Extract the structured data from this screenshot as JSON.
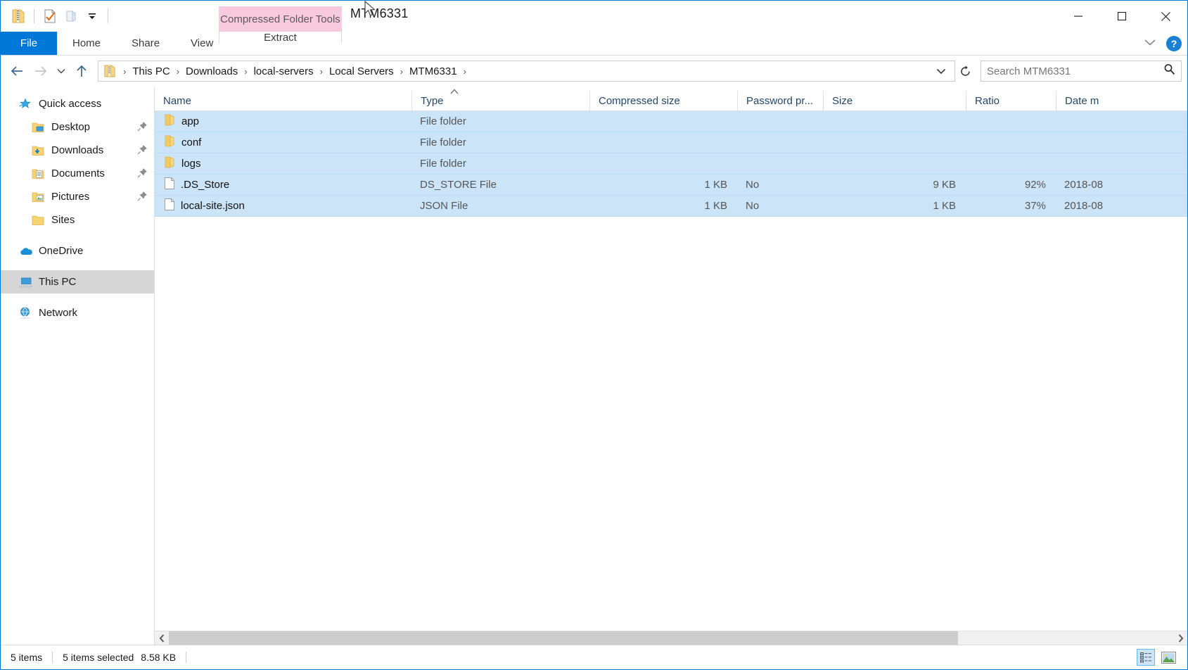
{
  "window": {
    "title": "MTM6331",
    "contextual_tab_group": "Compressed Folder Tools",
    "minimize_label": "Minimize",
    "maximize_label": "Maximize",
    "close_label": "Close",
    "ribbon_collapse_label": "Minimize the Ribbon",
    "help_label": "?"
  },
  "quick_access_toolbar": {
    "items": [
      {
        "name": "zipped-folder-icon",
        "label": "Compressed Folder"
      },
      {
        "name": "properties-icon",
        "label": "Properties"
      },
      {
        "name": "new-folder-icon",
        "label": "New folder"
      },
      {
        "name": "customize-dropdown-icon",
        "label": "Customize Quick Access Toolbar"
      }
    ]
  },
  "ribbon": {
    "tabs": [
      {
        "label": "File",
        "selected": true
      },
      {
        "label": "Home",
        "selected": false
      },
      {
        "label": "Share",
        "selected": false
      },
      {
        "label": "View",
        "selected": false
      }
    ],
    "contextual_tab": {
      "label": "Extract",
      "selected": false
    }
  },
  "address_bar": {
    "back_label": "Back",
    "forward_label": "Forward",
    "recent_label": "Recent locations",
    "up_label": "Up to Local Servers",
    "path_icon": "zipped-folder-icon",
    "breadcrumbs": [
      "This PC",
      "Downloads",
      "local-servers",
      "Local Servers",
      "MTM6331"
    ],
    "separator": "›",
    "dropdown_label": "Previous locations",
    "refresh_label": "Refresh"
  },
  "search": {
    "placeholder": "Search MTM6331",
    "value": "",
    "icon": "search-icon"
  },
  "sidebar": {
    "groups": [
      {
        "name": "quick-access",
        "label": "Quick access",
        "icon": "star-icon",
        "children": [
          {
            "label": "Desktop",
            "icon": "folder-desktop-icon",
            "pinned": true
          },
          {
            "label": "Downloads",
            "icon": "folder-downloads-icon",
            "pinned": true
          },
          {
            "label": "Documents",
            "icon": "folder-documents-icon",
            "pinned": true
          },
          {
            "label": "Pictures",
            "icon": "folder-pictures-icon",
            "pinned": true
          },
          {
            "label": "Sites",
            "icon": "folder-icon",
            "pinned": false
          }
        ]
      },
      {
        "name": "onedrive",
        "label": "OneDrive",
        "icon": "cloud-icon",
        "children": []
      },
      {
        "name": "this-pc",
        "label": "This PC",
        "icon": "computer-icon",
        "children": [],
        "selected": true
      },
      {
        "name": "network",
        "label": "Network",
        "icon": "network-icon",
        "children": []
      }
    ]
  },
  "file_list": {
    "columns": [
      {
        "key": "name",
        "label": "Name",
        "sorted": "asc"
      },
      {
        "key": "type",
        "label": "Type"
      },
      {
        "key": "compressed_size",
        "label": "Compressed size"
      },
      {
        "key": "password_protected",
        "label": "Password pr..."
      },
      {
        "key": "size",
        "label": "Size"
      },
      {
        "key": "ratio",
        "label": "Ratio"
      },
      {
        "key": "date_modified",
        "label": "Date m"
      }
    ],
    "rows": [
      {
        "name": "app",
        "icon": "folder-icon",
        "type": "File folder",
        "compressed_size": "",
        "password_protected": "",
        "size": "",
        "ratio": "",
        "date_modified": "",
        "selected": true
      },
      {
        "name": "conf",
        "icon": "folder-icon",
        "type": "File folder",
        "compressed_size": "",
        "password_protected": "",
        "size": "",
        "ratio": "",
        "date_modified": "",
        "selected": true
      },
      {
        "name": "logs",
        "icon": "folder-icon",
        "type": "File folder",
        "compressed_size": "",
        "password_protected": "",
        "size": "",
        "ratio": "",
        "date_modified": "",
        "selected": true
      },
      {
        "name": ".DS_Store",
        "icon": "file-icon",
        "type": "DS_STORE File",
        "compressed_size": "1 KB",
        "password_protected": "No",
        "size": "9 KB",
        "ratio": "92%",
        "date_modified": "2018-08",
        "selected": true
      },
      {
        "name": "local-site.json",
        "icon": "file-icon",
        "type": "JSON File",
        "compressed_size": "1 KB",
        "password_protected": "No",
        "size": "1 KB",
        "ratio": "37%",
        "date_modified": "2018-08",
        "selected": true
      }
    ]
  },
  "scrollbar": {
    "left_arrow": "‹",
    "right_arrow": "›"
  },
  "status_bar": {
    "item_count": "5 items",
    "selection": "5 items selected",
    "selection_size": "8.58 KB",
    "views": [
      {
        "name": "details-view-button",
        "label": "Details view",
        "active": true
      },
      {
        "name": "large-icons-view-button",
        "label": "Large icons view",
        "active": false
      }
    ]
  },
  "colors": {
    "accent": "#0078d7",
    "selection": "#cce4f7",
    "contextual_tab": "#f9c9de",
    "header_text": "#24476b"
  }
}
